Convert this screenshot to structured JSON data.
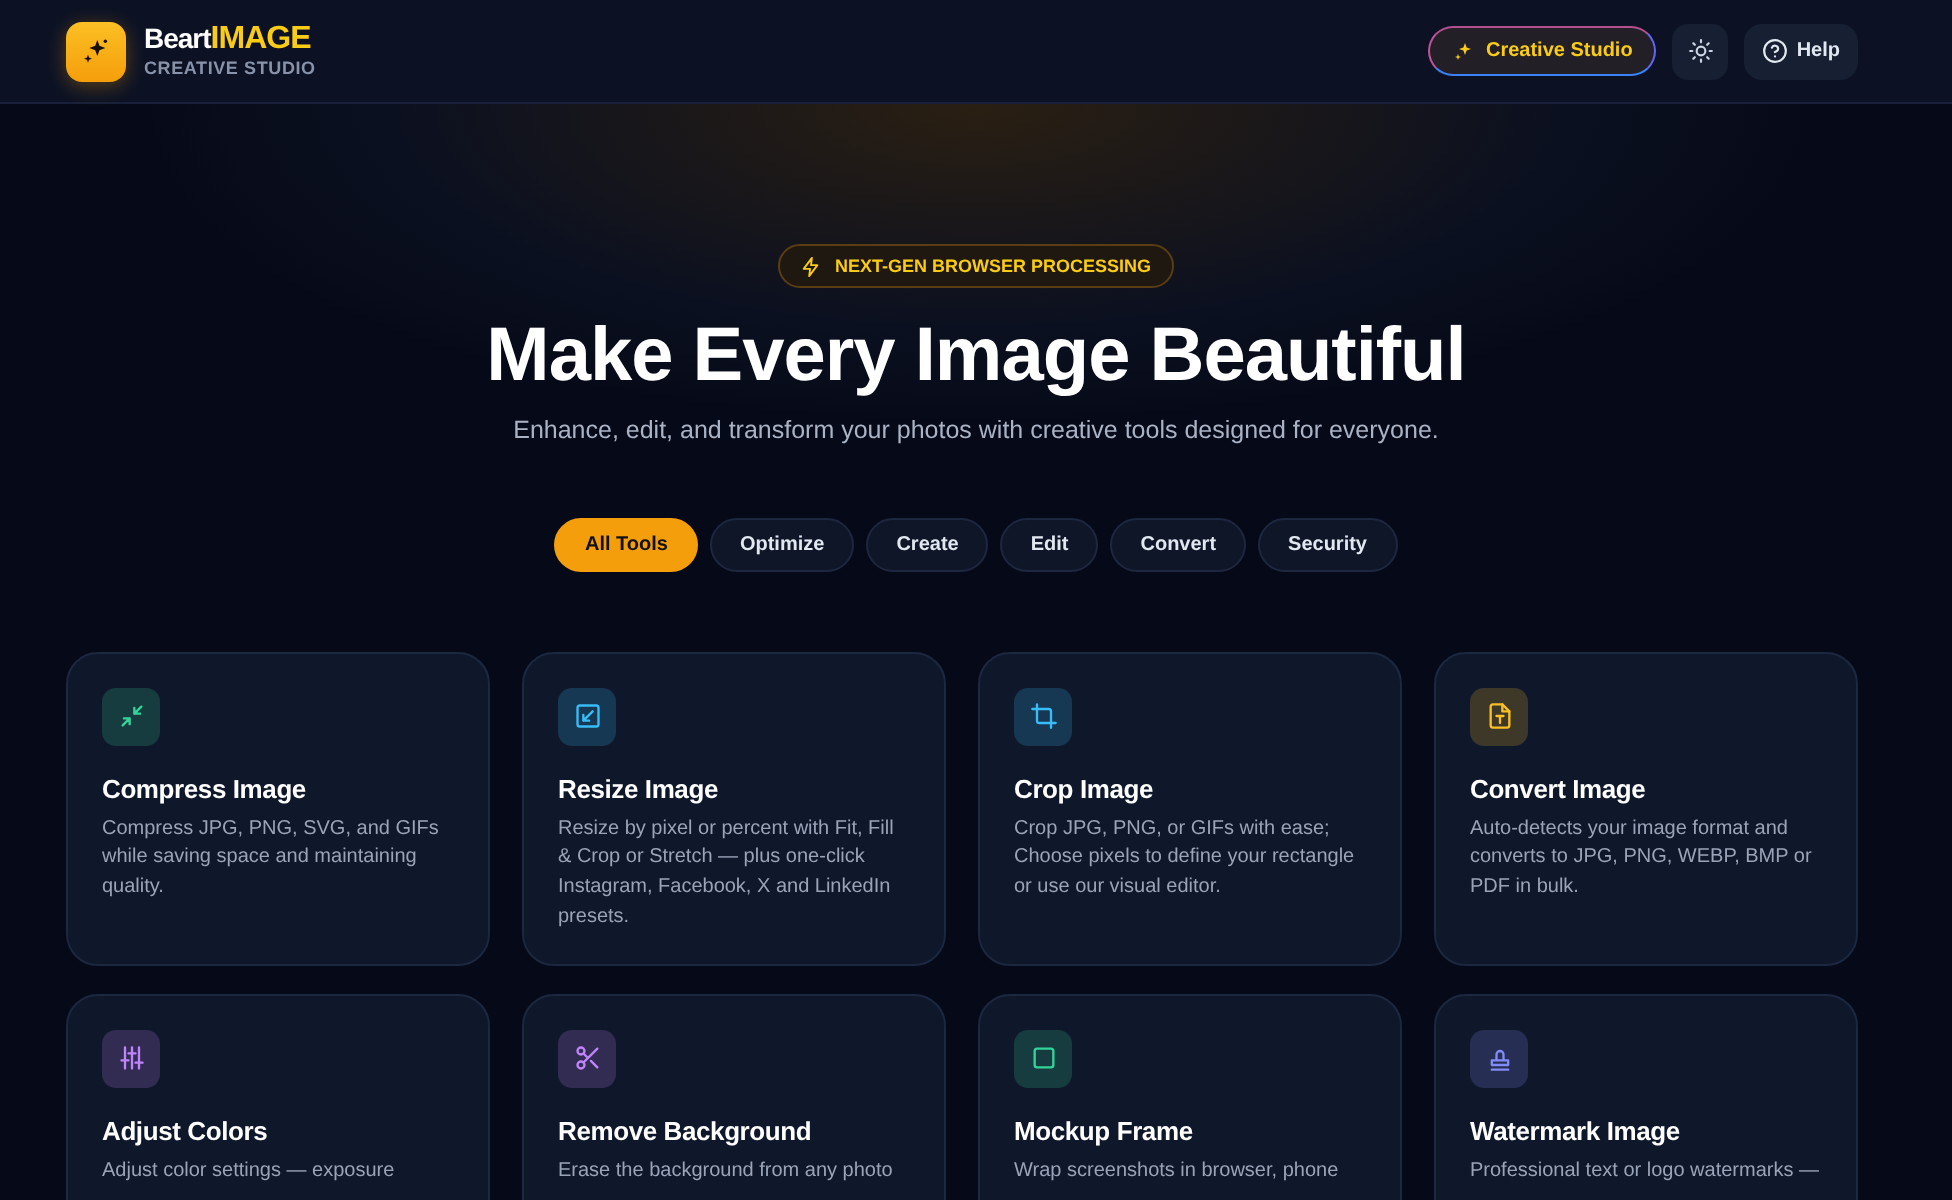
{
  "brand": {
    "name": "Beart",
    "highlight": "IMAGE",
    "tagline": "CREATIVE STUDIO"
  },
  "header_actions": {
    "studio_button": "Creative Studio",
    "help_button": "Help"
  },
  "hero": {
    "badge": "NEXT-GEN BROWSER PROCESSING",
    "title": "Make Every Image Beautiful",
    "subtitle": "Enhance, edit, and transform your photos with creative tools designed for everyone."
  },
  "tabs": [
    {
      "label": "All Tools",
      "selected": true
    },
    {
      "label": "Optimize",
      "selected": false
    },
    {
      "label": "Create",
      "selected": false
    },
    {
      "label": "Edit",
      "selected": false
    },
    {
      "label": "Convert",
      "selected": false
    },
    {
      "label": "Security",
      "selected": false
    }
  ],
  "tools": [
    {
      "kind": "compress",
      "color": "#34d399",
      "title": "Compress Image",
      "description": "Compress JPG, PNG, SVG, and GIFs while saving space and maintaining quality."
    },
    {
      "kind": "resize",
      "color": "#38bdf8",
      "title": "Resize Image",
      "description": "Resize by pixel or percent with Fit, Fill & Crop or Stretch — plus one-click Instagram, Facebook, X and LinkedIn presets."
    },
    {
      "kind": "crop",
      "color": "#38bdf8",
      "title": "Crop Image",
      "description": "Crop JPG, PNG, or GIFs with ease; Choose pixels to define your rectangle or use our visual editor."
    },
    {
      "kind": "convert",
      "color": "#fbbf24",
      "title": "Convert Image",
      "description": "Auto-detects your image format and converts to JPG, PNG, WEBP, BMP or PDF in bulk."
    },
    {
      "kind": "adjust",
      "color": "#c084fc",
      "title": "Adjust Colors",
      "description": "Adjust color settings — exposure"
    },
    {
      "kind": "cut",
      "color": "#c084fc",
      "title": "Remove Background",
      "description": "Erase the background from any photo"
    },
    {
      "kind": "frame",
      "color": "#34d399",
      "title": "Mockup Frame",
      "description": "Wrap screenshots in browser, phone"
    },
    {
      "kind": "stamp",
      "color": "#818cf8",
      "title": "Watermark Image",
      "description": "Professional text or logo watermarks —"
    }
  ]
}
